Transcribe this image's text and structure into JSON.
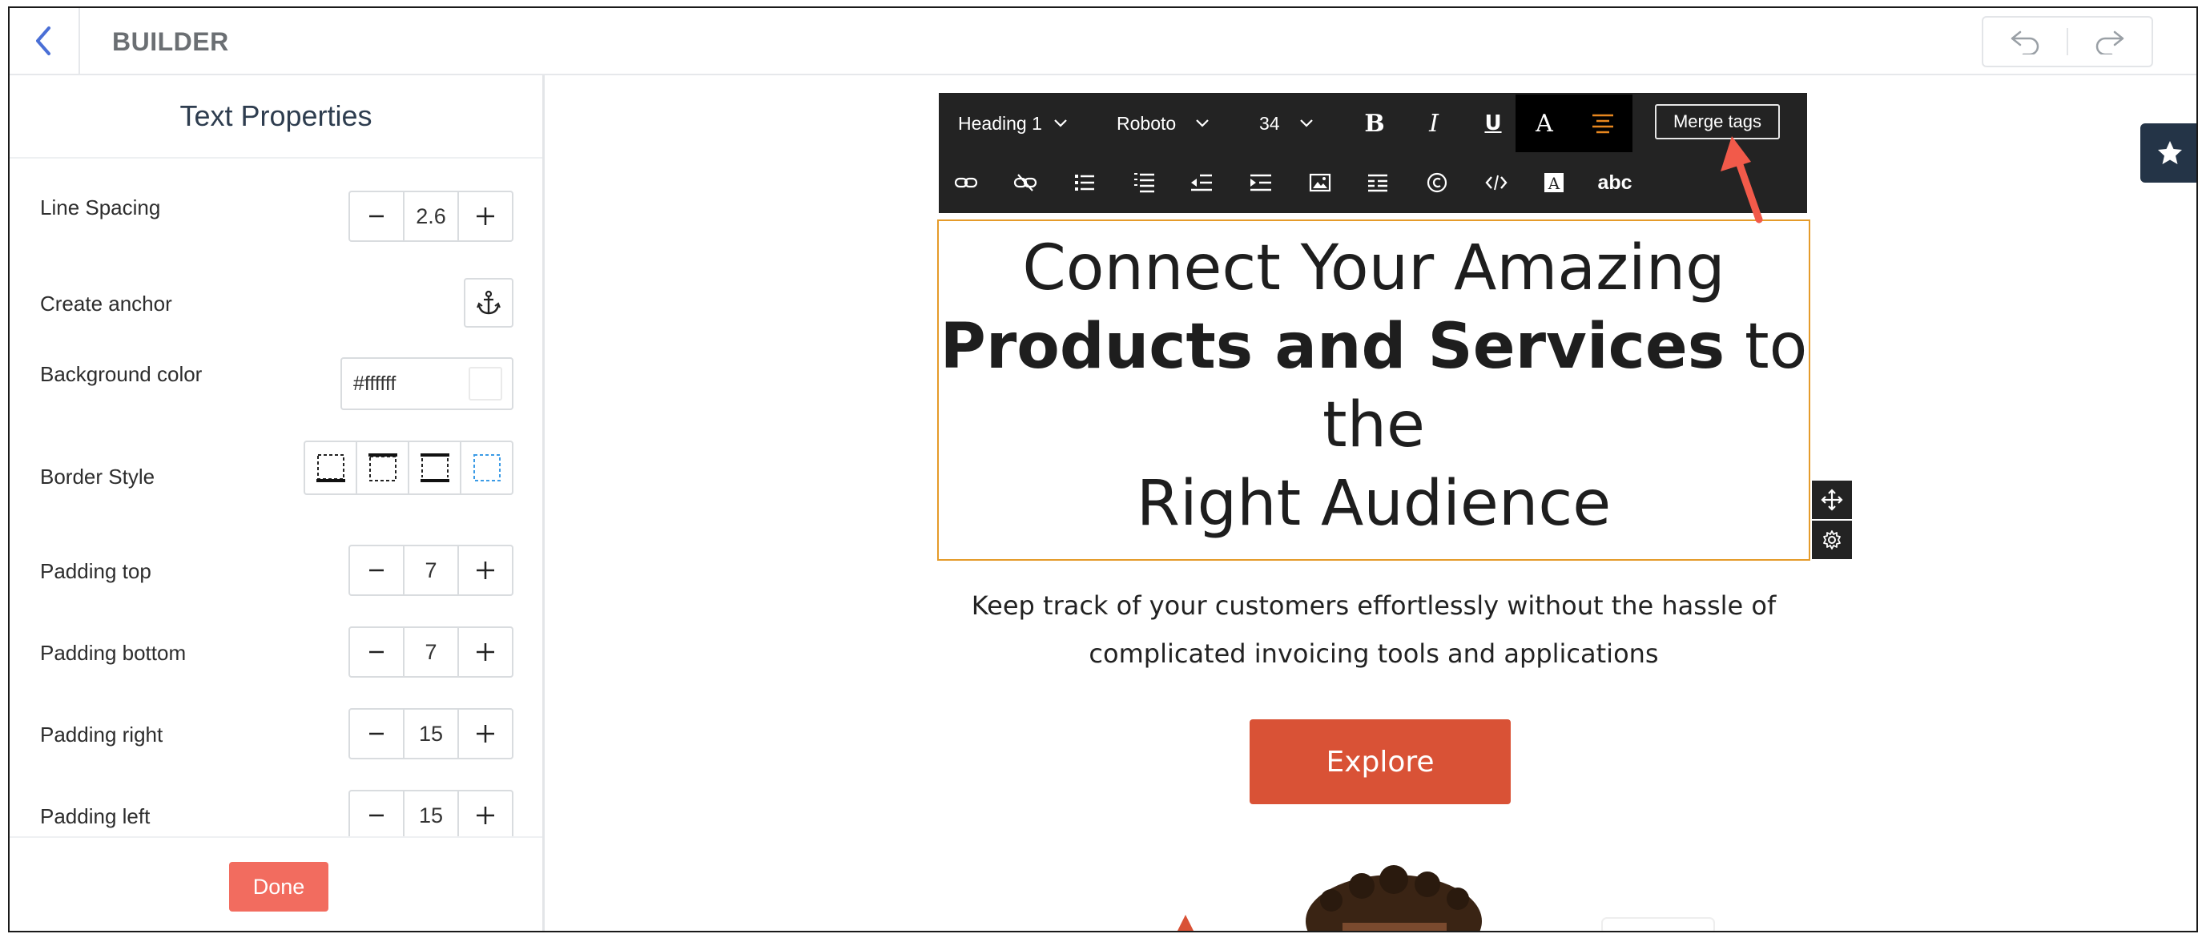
{
  "header": {
    "title": "BUILDER",
    "icons": [
      "chevron-left-icon",
      "undo-icon",
      "redo-icon"
    ]
  },
  "left_panel": {
    "title": "Text Properties",
    "line_spacing": {
      "label": "Line Spacing",
      "value": "2.6"
    },
    "create_anchor": {
      "label": "Create anchor",
      "icon": "anchor-icon"
    },
    "background_color": {
      "label": "Background color",
      "value": "#ffffff",
      "swatch": "#ffffff"
    },
    "border_style": {
      "label": "Border Style",
      "options": [
        "border-bottom-icon",
        "border-top-icon",
        "border-top-bottom-icon",
        "border-all-icon"
      ],
      "selected": "border-all-icon"
    },
    "padding_top": {
      "label": "Padding top",
      "value": "7"
    },
    "padding_bottom": {
      "label": "Padding bottom",
      "value": "7"
    },
    "padding_right": {
      "label": "Padding right",
      "value": "15"
    },
    "padding_left": {
      "label": "Padding left",
      "value": "15"
    },
    "done_label": "Done"
  },
  "toolbar": {
    "block_type": "Heading 1",
    "font": "Roboto",
    "font_size": "34",
    "merge_tags_label": "Merge tags",
    "abc_label": "abc"
  },
  "content": {
    "heading_line1": "Connect Your Amazing",
    "heading_bold": "Products and Services",
    "heading_line2_rest": " to",
    "heading_line3": "the",
    "heading_line4": "Right Audience",
    "subtext_line1": "Keep track of your customers effortlessly without the hassle of",
    "subtext_line2": "complicated invoicing tools and applications",
    "explore_label": "Explore"
  },
  "colors": {
    "accent_orange": "#e59b2a",
    "explore_red": "#d95236",
    "done_red": "#f26c5f",
    "toolbar_bg": "#232323",
    "callout_arrow": "#f25a4a"
  }
}
